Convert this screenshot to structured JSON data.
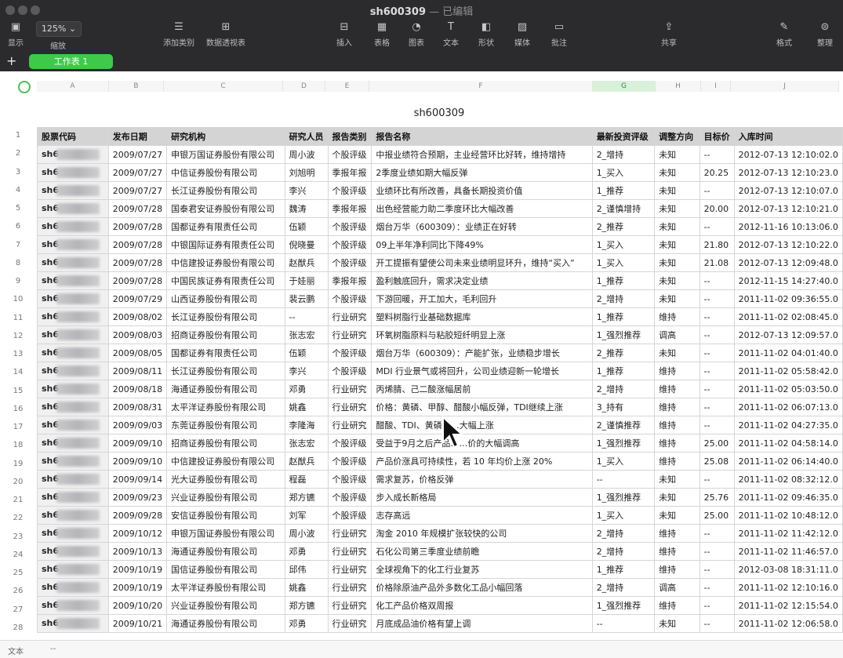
{
  "window": {
    "doc_title": "sh600309",
    "subtitle": "— 已编辑"
  },
  "toolbar": {
    "zoom": "125% ⌄",
    "items": [
      {
        "label": "显示",
        "icon": "sidebar-icon"
      },
      {
        "label": "缩放",
        "icon": "zoom-icon"
      },
      {
        "label": "添加类别",
        "icon": "add-category-icon"
      },
      {
        "label": "数据透视表",
        "icon": "pivot-table-icon"
      },
      {
        "label": "插入",
        "icon": "insert-icon"
      },
      {
        "label": "表格",
        "icon": "table-icon"
      },
      {
        "label": "图表",
        "icon": "chart-icon"
      },
      {
        "label": "文本",
        "icon": "text-icon"
      },
      {
        "label": "形状",
        "icon": "shape-icon"
      },
      {
        "label": "媒体",
        "icon": "media-icon"
      },
      {
        "label": "批注",
        "icon": "comment-icon"
      },
      {
        "label": "共享",
        "icon": "share-icon"
      },
      {
        "label": "格式",
        "icon": "format-brush-icon"
      },
      {
        "label": "整理",
        "icon": "organize-icon"
      }
    ]
  },
  "sheet_tabs": {
    "add": "+",
    "active": "工作表 1"
  },
  "column_letters": [
    "A",
    "B",
    "C",
    "D",
    "E",
    "F",
    "G",
    "H",
    "I",
    "J"
  ],
  "row_numbers": [
    "1",
    "2",
    "3",
    "4",
    "5",
    "6",
    "7",
    "8",
    "9",
    "10",
    "11",
    "12",
    "13",
    "14",
    "15",
    "16",
    "17",
    "18",
    "19",
    "20",
    "21",
    "22",
    "23",
    "24",
    "25",
    "26",
    "27",
    "28"
  ],
  "table": {
    "title": "sh600309",
    "headers": [
      "股票代码",
      "发布日期",
      "研究机构",
      "研究人员",
      "报告类别",
      "报告名称",
      "最新投资评级",
      "调整方向",
      "目标价",
      "入库时间"
    ],
    "code_prefix": "sh6",
    "rows": [
      [
        "2009/07/27",
        "申银万国证券股份有限公司",
        "周小波",
        "个股评级",
        "中报业绩符合预期，主业经营环比好转，维持增持",
        "2_增持",
        "未知",
        "--",
        "2012-07-13 12:10:02.0"
      ],
      [
        "2009/07/27",
        "中信证券股份有限公司",
        "刘旭明",
        "季报年报",
        "2季度业绩如期大幅反弹",
        "1_买入",
        "未知",
        "20.25",
        "2012-07-13 12:10:23.0"
      ],
      [
        "2009/07/27",
        "长江证券股份有限公司",
        "李兴",
        "个股评级",
        "业绩环比有所改善，具备长期投资价值",
        "1_推荐",
        "未知",
        "--",
        "2012-07-13 12:10:07.0"
      ],
      [
        "2009/07/28",
        "国泰君安证券股份有限公司",
        "魏涛",
        "季报年报",
        "出色经营能力助二季度环比大幅改善",
        "2_谨慎增持",
        "未知",
        "20.00",
        "2012-07-13 12:10:21.0"
      ],
      [
        "2009/07/28",
        "国都证券有限责任公司",
        "伍颖",
        "个股评级",
        "烟台万华（600309）：业绩正在好转",
        "2_推荐",
        "未知",
        "--",
        "2012-11-16 10:13:06.0"
      ],
      [
        "2009/07/28",
        "中银国际证券有限责任公司",
        "倪晓曼",
        "个股评级",
        "09上半年净利同比下降49%",
        "1_买入",
        "未知",
        "21.80",
        "2012-07-13 12:10:22.0"
      ],
      [
        "2009/07/28",
        "中信建投证券股份有限公司",
        "赵猷兵",
        "个股评级",
        "开工提振有望使公司未来业绩明显环升，维持“买入”",
        "1_买入",
        "未知",
        "21.08",
        "2012-07-13 12:09:48.0"
      ],
      [
        "2009/07/28",
        "中国民族证券有限责任公司",
        "于娃丽",
        "季报年报",
        "盈利触底回升，需求决定业绩",
        "1_推荐",
        "未知",
        "--",
        "2012-11-15 14:27:40.0"
      ],
      [
        "2009/07/29",
        "山西证券股份有限公司",
        "裴云鹏",
        "个股评级",
        "下游回暖，开工加大，毛利回升",
        "2_增持",
        "未知",
        "--",
        "2011-11-02 09:36:55.0"
      ],
      [
        "2009/08/02",
        "长江证券股份有限公司",
        "--",
        "行业研究",
        "塑料树脂行业基础数据库",
        "1_推荐",
        "维持",
        "--",
        "2011-11-02 02:08:45.0"
      ],
      [
        "2009/08/03",
        "招商证券股份有限公司",
        "张志宏",
        "行业研究",
        "环氧树脂原料与粘胶短纤明显上涨",
        "1_强烈推荐",
        "调高",
        "--",
        "2012-07-13 12:09:57.0"
      ],
      [
        "2009/08/05",
        "国都证券有限责任公司",
        "伍颖",
        "个股评级",
        "烟台万华（600309）：产能扩张，业绩稳步增长",
        "2_推荐",
        "未知",
        "--",
        "2011-11-02 04:01:40.0"
      ],
      [
        "2009/08/11",
        "长江证券股份有限公司",
        "李兴",
        "个股评级",
        "MDI 行业景气或将回升，公司业绩迎新一轮增长",
        "1_推荐",
        "维持",
        "--",
        "2011-11-02 05:58:42.0"
      ],
      [
        "2009/08/18",
        "海通证券股份有限公司",
        "邓勇",
        "行业研究",
        "丙烯腈、己二酸涨幅居前",
        "2_增持",
        "维持",
        "--",
        "2011-11-02 05:03:50.0"
      ],
      [
        "2009/08/31",
        "太平洋证券股份有限公司",
        "姚鑫",
        "行业研究",
        "价格：黄磷、甲醇、醋酸小幅反弹，TDI继续上涨",
        "3_持有",
        "维持",
        "--",
        "2011-11-02 06:07:13.0"
      ],
      [
        "2009/09/03",
        "东莞证券股份有限公司",
        "李隆海",
        "行业研究",
        "醋酸、TDI、黄磷……大幅上涨",
        "2_谨慎推荐",
        "维持",
        "--",
        "2011-11-02 04:27:35.0"
      ],
      [
        "2009/09/10",
        "招商证券股份有限公司",
        "张志宏",
        "个股评级",
        "受益于9月之后产品……价的大幅调高",
        "1_强烈推荐",
        "维持",
        "25.00",
        "2011-11-02 04:58:14.0"
      ],
      [
        "2009/09/10",
        "中信建投证券股份有限公司",
        "赵猷兵",
        "个股评级",
        "产品价涨具可持续性，若 10 年均价上涨 20%",
        "1_买入",
        "维持",
        "25.08",
        "2011-11-02 06:14:40.0"
      ],
      [
        "2009/09/14",
        "光大证券股份有限公司",
        "程磊",
        "个股评级",
        "需求复苏，价格反弹",
        "--",
        "未知",
        "--",
        "2011-11-02 08:32:12.0"
      ],
      [
        "2009/09/23",
        "兴业证券股份有限公司",
        "郑方镳",
        "个股评级",
        "步入成长新格局",
        "1_强烈推荐",
        "未知",
        "25.76",
        "2011-11-02 09:46:35.0"
      ],
      [
        "2009/09/28",
        "安信证券股份有限公司",
        "刘军",
        "个股评级",
        "志存高远",
        "1_买入",
        "未知",
        "25.00",
        "2011-11-02 10:48:12.0"
      ],
      [
        "2009/10/12",
        "申银万国证券股份有限公司",
        "周小波",
        "行业研究",
        "淘金 2010 年规模扩张较快的公司",
        "2_增持",
        "维持",
        "--",
        "2011-11-02 11:42:12.0"
      ],
      [
        "2009/10/13",
        "海通证券股份有限公司",
        "邓勇",
        "行业研究",
        "石化公司第三季度业绩前瞻",
        "2_增持",
        "维持",
        "--",
        "2011-11-02 11:46:57.0"
      ],
      [
        "2009/10/19",
        "国信证券股份有限公司",
        "邱伟",
        "行业研究",
        "全球视角下的化工行业复苏",
        "1_推荐",
        "维持",
        "--",
        "2012-03-08 18:31:11.0"
      ],
      [
        "2009/10/19",
        "太平洋证券股份有限公司",
        "姚鑫",
        "行业研究",
        "价格除原油产品外多数化工品小幅回落",
        "2_增持",
        "调高",
        "--",
        "2011-11-02 12:10:16.0"
      ],
      [
        "2009/10/20",
        "兴业证券股份有限公司",
        "郑方镳",
        "行业研究",
        "化工产品价格双周报",
        "1_强烈推荐",
        "维持",
        "--",
        "2011-11-02 12:15:54.0"
      ],
      [
        "2009/10/21",
        "海通证券股份有限公司",
        "邓勇",
        "行业研究",
        "月底成品油价格有望上调",
        "--",
        "未知",
        "--",
        "2011-11-02 12:06:58.0"
      ]
    ]
  },
  "status_bar": {
    "label": "文本",
    "value": "--"
  }
}
